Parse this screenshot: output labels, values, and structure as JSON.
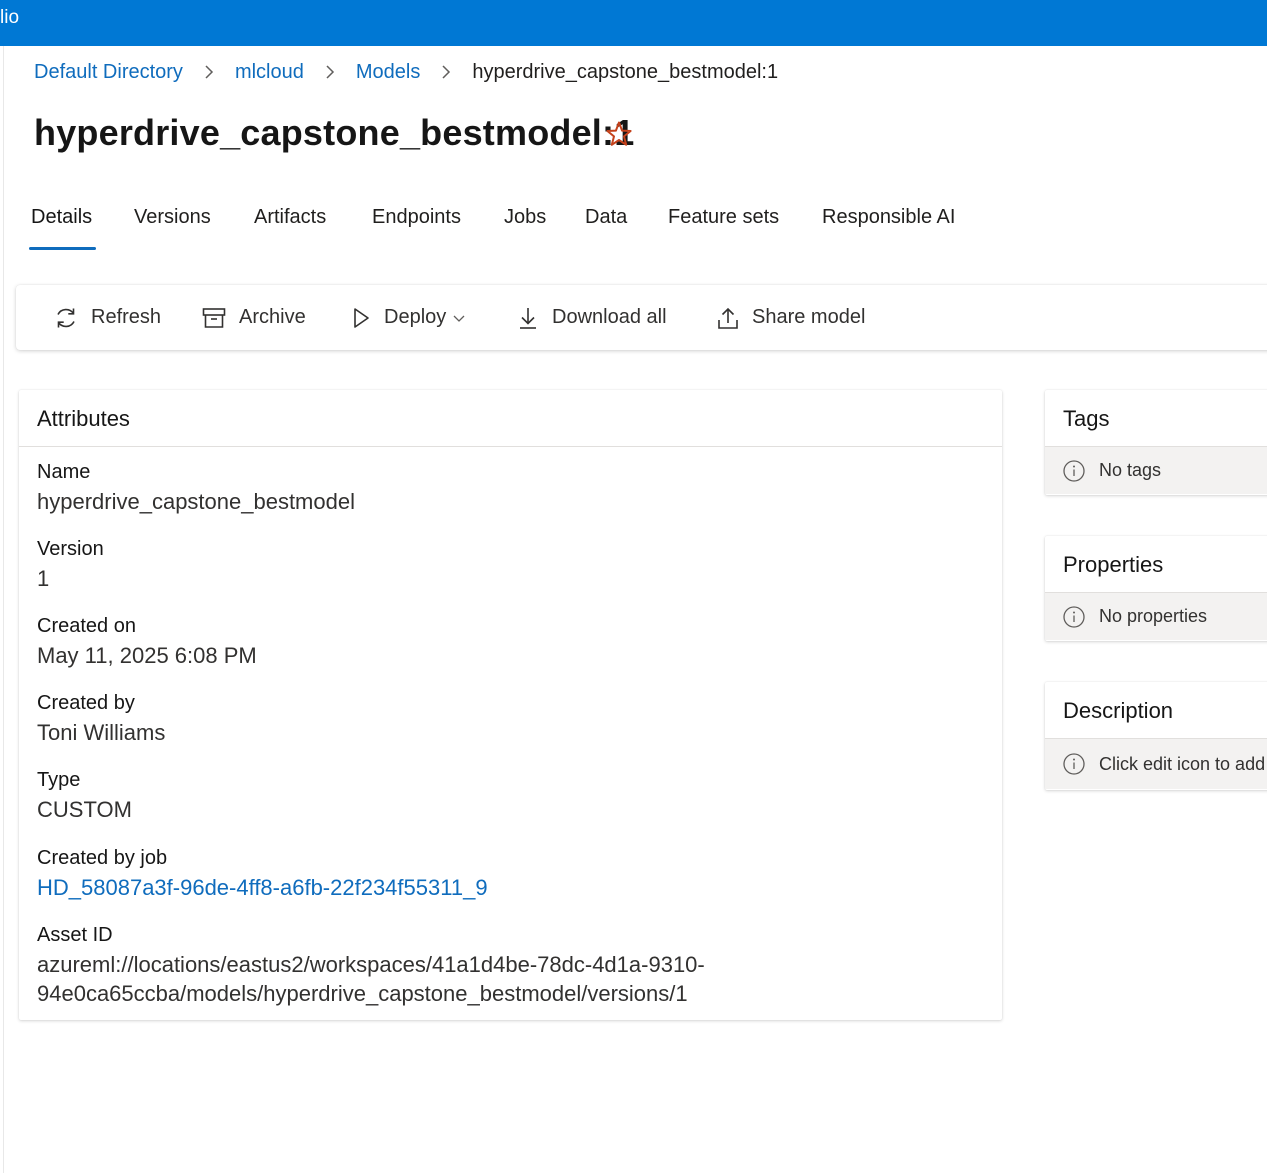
{
  "app": {
    "title_fragment": "lio"
  },
  "breadcrumb": {
    "items": [
      "Default Directory",
      "mlcloud",
      "Models"
    ],
    "current": "hyperdrive_capstone_bestmodel:1"
  },
  "page": {
    "title": "hyperdrive_capstone_bestmodel:1"
  },
  "tabs": [
    {
      "label": "Details",
      "active": true
    },
    {
      "label": "Versions"
    },
    {
      "label": "Artifacts"
    },
    {
      "label": "Endpoints"
    },
    {
      "label": "Jobs"
    },
    {
      "label": "Data"
    },
    {
      "label": "Feature sets"
    },
    {
      "label": "Responsible AI"
    }
  ],
  "toolbar": {
    "refresh": "Refresh",
    "archive": "Archive",
    "deploy": "Deploy",
    "download_all": "Download all",
    "share_model": "Share model"
  },
  "attributes": {
    "header": "Attributes",
    "name_label": "Name",
    "name_value": "hyperdrive_capstone_bestmodel",
    "version_label": "Version",
    "version_value": "1",
    "created_on_label": "Created on",
    "created_on_value": "May 11, 2025 6:08 PM",
    "created_by_label": "Created by",
    "created_by_value": "Toni Williams",
    "type_label": "Type",
    "type_value": "CUSTOM",
    "job_label": "Created by job",
    "job_value": "HD_58087a3f-96de-4ff8-a6fb-22f234f55311_9",
    "asset_label": "Asset ID",
    "asset_value_line1": "azureml://locations/eastus2/workspaces/41a1d4be-78dc-4d1a-9310-",
    "asset_value_line2": "94e0ca65ccba/models/hyperdrive_capstone_bestmodel/versions/1"
  },
  "tags": {
    "header": "Tags",
    "empty": "No tags"
  },
  "properties": {
    "header": "Properties",
    "empty": "No properties"
  },
  "description": {
    "header": "Description",
    "empty": "Click edit icon to add"
  },
  "colors": {
    "accent": "#0078d4",
    "link": "#0f6cbd",
    "star": "#c4411b"
  }
}
